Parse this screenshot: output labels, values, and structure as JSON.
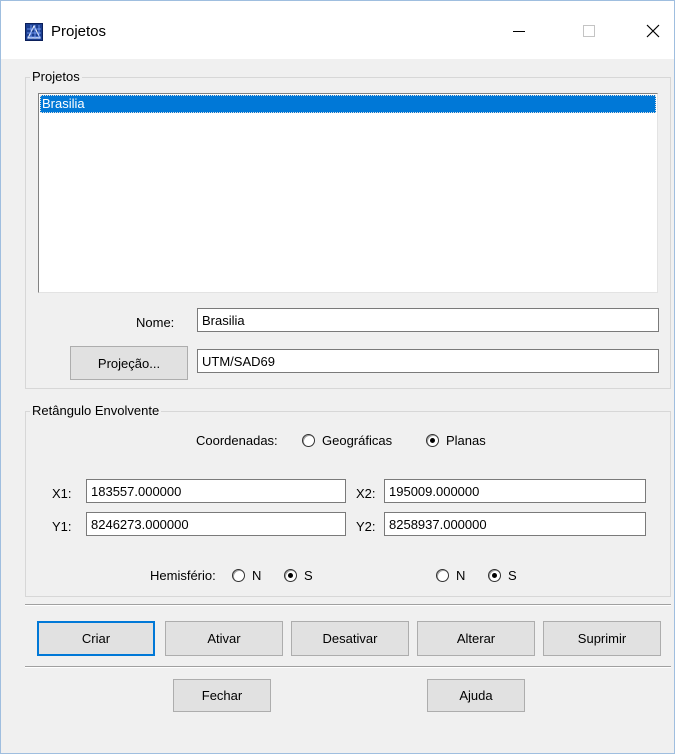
{
  "window": {
    "title": "Projetos",
    "icon": "grid-map-icon",
    "controls": [
      "minimize-icon",
      "maximize-icon",
      "close-icon"
    ]
  },
  "projects": {
    "group_label": "Projetos",
    "items": [
      {
        "label": "Brasilia",
        "selected": true
      }
    ],
    "name_label": "Nome:",
    "name_value": "Brasilia",
    "projection_button": "Projeção...",
    "projection_value": "UTM/SAD69"
  },
  "bounding_box": {
    "group_label": "Retângulo Envolvente",
    "coords_label": "Coordenadas:",
    "coord_options": [
      {
        "label": "Geográficas",
        "checked": false
      },
      {
        "label": "Planas",
        "checked": true
      }
    ],
    "x1_label": "X1:",
    "x1_value": "183557.000000",
    "x2_label": "X2:",
    "x2_value": "195009.000000",
    "y1_label": "Y1:",
    "y1_value": "8246273.000000",
    "y2_label": "Y2:",
    "y2_value": "8258937.000000",
    "hemisphere_label": "Hemisfério:",
    "hemisphere_left": [
      {
        "label": "N",
        "checked": false
      },
      {
        "label": "S",
        "checked": true
      }
    ],
    "hemisphere_right": [
      {
        "label": "N",
        "checked": false
      },
      {
        "label": "S",
        "checked": true
      }
    ]
  },
  "actions": {
    "create": "Criar",
    "activate": "Ativar",
    "deactivate": "Desativar",
    "alter": "Alterar",
    "delete": "Suprimir"
  },
  "footer": {
    "close": "Fechar",
    "help": "Ajuda"
  },
  "colors": {
    "selection": "#0078d7",
    "window_bg": "#f0f0f0",
    "focus_border": "#0078d7"
  }
}
